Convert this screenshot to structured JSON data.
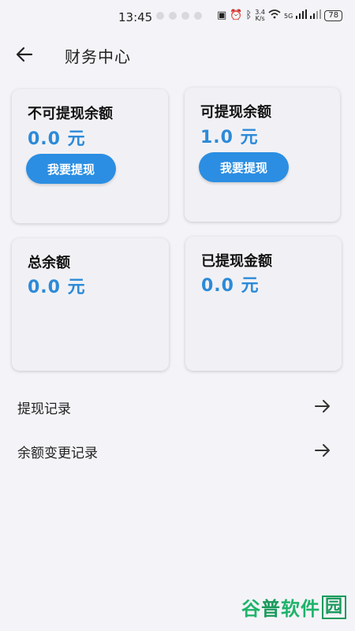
{
  "status_bar": {
    "time": "13:45",
    "net_speed_top": "3.4",
    "net_speed_bottom": "K/s",
    "signal_label": "5G",
    "battery": "78"
  },
  "header": {
    "title": "财务中心"
  },
  "cards": {
    "non_withdrawable": {
      "label": "不可提现余额",
      "amount": "0.0 元",
      "button": "我要提现"
    },
    "withdrawable": {
      "label": "可提现余额",
      "amount": "1.0 元",
      "button": "我要提现"
    },
    "total": {
      "label": "总余额",
      "amount": "0.0 元"
    },
    "withdrawn": {
      "label": "已提现金额",
      "amount": "0.0 元"
    }
  },
  "list": {
    "withdraw_records": "提现记录",
    "balance_change_records": "余额变更记录"
  },
  "watermark": {
    "part_a": "谷",
    "part_b": "普",
    "part_c": "软件",
    "part_d": "园"
  },
  "colors": {
    "accent": "#2b8ee2",
    "amount": "#2c8ad8",
    "background": "#f4f4f8"
  }
}
